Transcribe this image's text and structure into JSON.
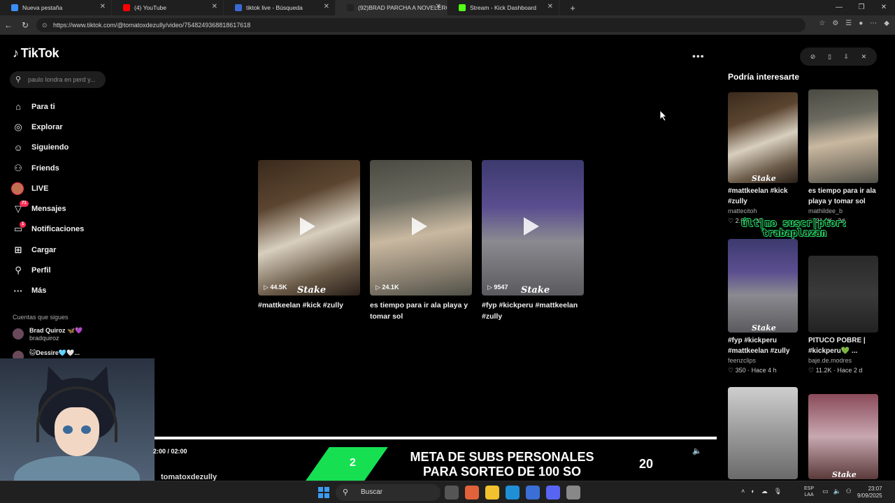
{
  "browser": {
    "tabs": [
      {
        "label": "Nueva pestaña",
        "color": "#3a8ef5"
      },
      {
        "label": "(4) YouTube",
        "color": "#ff0000"
      },
      {
        "label": "tiktok live - Búsqueda",
        "color": "#3a6ad6"
      },
      {
        "label": "(92)BRAD PARCHA A NOVELERO :(",
        "color": "#222222"
      },
      {
        "label": "Stream - Kick Dashboard",
        "color": "#53fc18"
      }
    ],
    "url": "https://www.tiktok.com/@tomatoxdezully/video/7548249368818617618"
  },
  "tiktok": {
    "logo_text": "TikTok",
    "search_placeholder": "paulo londra en perd y...",
    "nav": [
      {
        "label": "Para ti",
        "icon": "home-icon",
        "glyph": "⌂"
      },
      {
        "label": "Explorar",
        "icon": "compass-icon",
        "glyph": "◎"
      },
      {
        "label": "Siguiendo",
        "icon": "following-icon",
        "glyph": "☺"
      },
      {
        "label": "Friends",
        "icon": "friends-icon",
        "glyph": "⚇"
      },
      {
        "label": "LIVE",
        "icon": "live-avatar-icon",
        "glyph": ""
      },
      {
        "label": "Mensajes",
        "icon": "messages-icon",
        "glyph": "▽",
        "badge": "71"
      },
      {
        "label": "Notificaciones",
        "icon": "notifications-icon",
        "glyph": "▭",
        "badge": "1"
      },
      {
        "label": "Cargar",
        "icon": "upload-icon",
        "glyph": "⊞"
      },
      {
        "label": "Perfil",
        "icon": "profile-icon",
        "glyph": "⚲"
      },
      {
        "label": "Más",
        "icon": "more-icon",
        "glyph": "···"
      }
    ],
    "following_title": "Cuentas que sigues",
    "following": [
      {
        "name": "Brad Quiroz 🦋💜",
        "handle": "bradquiroz"
      },
      {
        "name": "🐱Dessire🩵🤍...",
        "handle": ""
      }
    ]
  },
  "videos": [
    {
      "title": "#mattkeelan #kick #zully",
      "views": "44.5K"
    },
    {
      "title": "es tiempo para ir ala playa y tomar sol",
      "views": "24.1K"
    },
    {
      "title": "#fyp #kickperu #mattkeelan #zully",
      "views": "9547"
    }
  ],
  "thumb_watermark": "Stake",
  "right": {
    "title": "Podría interesarte",
    "items": [
      {
        "title": "#mattkeelan #kick #zully",
        "author": "mattecitoh",
        "stats": "♡ 2.9M · 20"
      },
      {
        "title": "es tiempo para ir ala playa y tomar sol",
        "author": "mathildee_b",
        "stats": "♡ 31.6K · 2d"
      },
      {
        "title": "#fyp #kickperu #mattkeelan #zully",
        "author": "feenzclips",
        "stats": "♡ 350 · Hace 4 h"
      },
      {
        "title": "PITUCO POBRE | #kickperu💚 ...",
        "author": "baje.de.modres",
        "stats": "♡ 11.2K · Hace 2 d"
      }
    ]
  },
  "overlay_text": "últ|mo suscr|ptor: trabaplazan",
  "player": {
    "timecode": "2:00 / 02:00",
    "author_peek": "tomatoxdezully"
  },
  "banner": {
    "left_number": "2",
    "message": "META DE SUBS PERSONALES PARA SORTEO DE 100 SO",
    "right_number": "20"
  },
  "taskbar": {
    "search_label": "Buscar",
    "lang": "ESP\nLAA",
    "time": "23:07",
    "date": "9/09/2025"
  }
}
